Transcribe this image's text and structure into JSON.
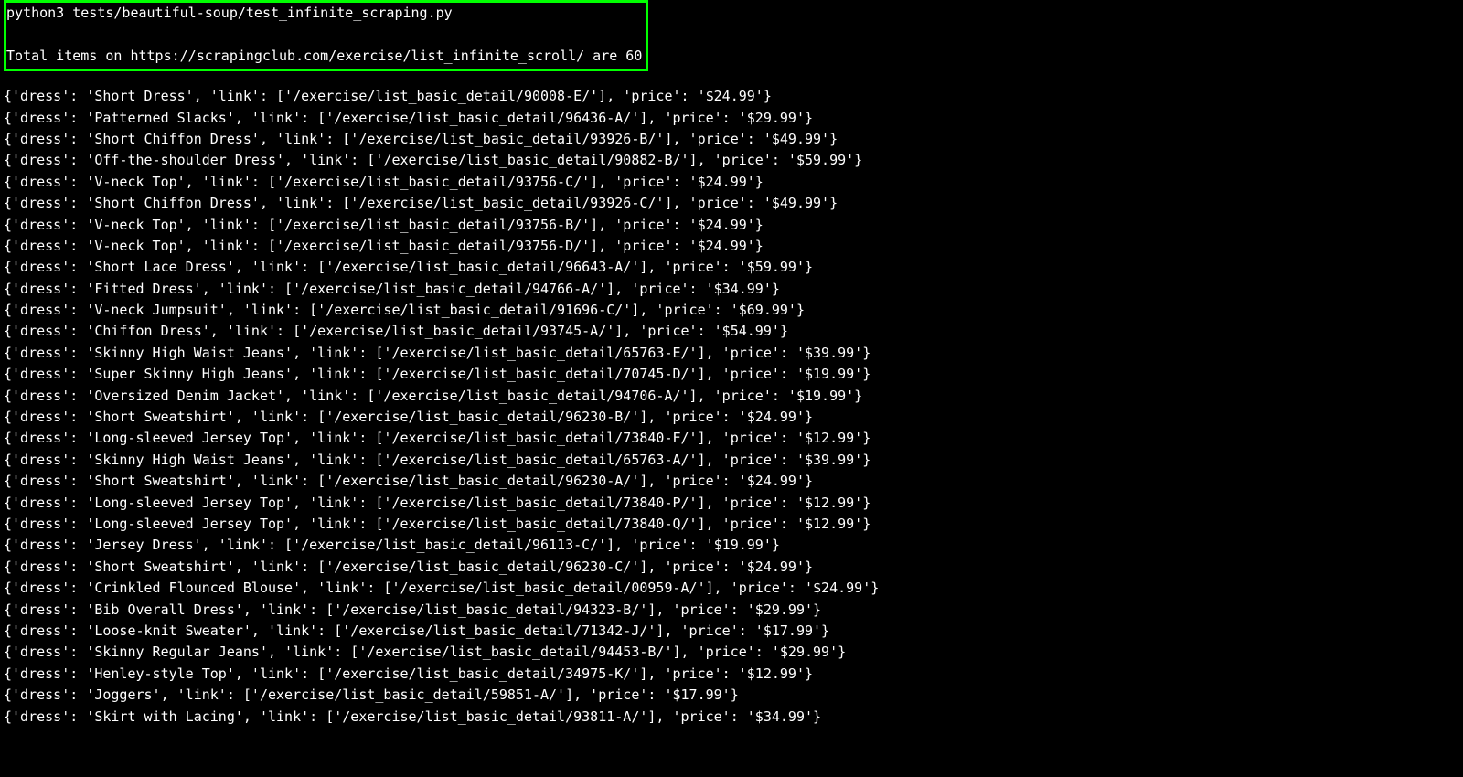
{
  "command": "python3 tests/beautiful-soup/test_infinite_scraping.py",
  "summary": "Total items on https://scrapingclub.com/exercise/list_infinite_scroll/ are 60",
  "items": [
    {
      "dress": "Short Dress",
      "link": "/exercise/list_basic_detail/90008-E/",
      "price": "$24.99"
    },
    {
      "dress": "Patterned Slacks",
      "link": "/exercise/list_basic_detail/96436-A/",
      "price": "$29.99"
    },
    {
      "dress": "Short Chiffon Dress",
      "link": "/exercise/list_basic_detail/93926-B/",
      "price": "$49.99"
    },
    {
      "dress": "Off-the-shoulder Dress",
      "link": "/exercise/list_basic_detail/90882-B/",
      "price": "$59.99"
    },
    {
      "dress": "V-neck Top",
      "link": "/exercise/list_basic_detail/93756-C/",
      "price": "$24.99"
    },
    {
      "dress": "Short Chiffon Dress",
      "link": "/exercise/list_basic_detail/93926-C/",
      "price": "$49.99"
    },
    {
      "dress": "V-neck Top",
      "link": "/exercise/list_basic_detail/93756-B/",
      "price": "$24.99"
    },
    {
      "dress": "V-neck Top",
      "link": "/exercise/list_basic_detail/93756-D/",
      "price": "$24.99"
    },
    {
      "dress": "Short Lace Dress",
      "link": "/exercise/list_basic_detail/96643-A/",
      "price": "$59.99"
    },
    {
      "dress": "Fitted Dress",
      "link": "/exercise/list_basic_detail/94766-A/",
      "price": "$34.99"
    },
    {
      "dress": "V-neck Jumpsuit",
      "link": "/exercise/list_basic_detail/91696-C/",
      "price": "$69.99"
    },
    {
      "dress": "Chiffon Dress",
      "link": "/exercise/list_basic_detail/93745-A/",
      "price": "$54.99"
    },
    {
      "dress": "Skinny High Waist Jeans",
      "link": "/exercise/list_basic_detail/65763-E/",
      "price": "$39.99"
    },
    {
      "dress": "Super Skinny High Jeans",
      "link": "/exercise/list_basic_detail/70745-D/",
      "price": "$19.99"
    },
    {
      "dress": "Oversized Denim Jacket",
      "link": "/exercise/list_basic_detail/94706-A/",
      "price": "$19.99"
    },
    {
      "dress": "Short Sweatshirt",
      "link": "/exercise/list_basic_detail/96230-B/",
      "price": "$24.99"
    },
    {
      "dress": "Long-sleeved Jersey Top",
      "link": "/exercise/list_basic_detail/73840-F/",
      "price": "$12.99"
    },
    {
      "dress": "Skinny High Waist Jeans",
      "link": "/exercise/list_basic_detail/65763-A/",
      "price": "$39.99"
    },
    {
      "dress": "Short Sweatshirt",
      "link": "/exercise/list_basic_detail/96230-A/",
      "price": "$24.99"
    },
    {
      "dress": "Long-sleeved Jersey Top",
      "link": "/exercise/list_basic_detail/73840-P/",
      "price": "$12.99"
    },
    {
      "dress": "Long-sleeved Jersey Top",
      "link": "/exercise/list_basic_detail/73840-Q/",
      "price": "$12.99"
    },
    {
      "dress": "Jersey Dress",
      "link": "/exercise/list_basic_detail/96113-C/",
      "price": "$19.99"
    },
    {
      "dress": "Short Sweatshirt",
      "link": "/exercise/list_basic_detail/96230-C/",
      "price": "$24.99"
    },
    {
      "dress": "Crinkled Flounced Blouse",
      "link": "/exercise/list_basic_detail/00959-A/",
      "price": "$24.99"
    },
    {
      "dress": "Bib Overall Dress",
      "link": "/exercise/list_basic_detail/94323-B/",
      "price": "$29.99"
    },
    {
      "dress": "Loose-knit Sweater",
      "link": "/exercise/list_basic_detail/71342-J/",
      "price": "$17.99"
    },
    {
      "dress": "Skinny Regular Jeans",
      "link": "/exercise/list_basic_detail/94453-B/",
      "price": "$29.99"
    },
    {
      "dress": "Henley-style Top",
      "link": "/exercise/list_basic_detail/34975-K/",
      "price": "$12.99"
    },
    {
      "dress": "Joggers",
      "link": "/exercise/list_basic_detail/59851-A/",
      "price": "$17.99"
    },
    {
      "dress": "Skirt with Lacing",
      "link": "/exercise/list_basic_detail/93811-A/",
      "price": "$34.99"
    }
  ]
}
